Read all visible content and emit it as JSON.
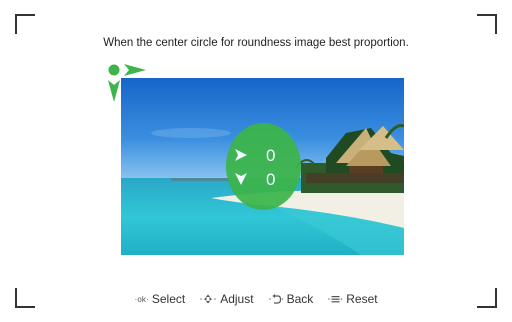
{
  "instruction": "When the center circle for roundness image best proportion.",
  "overlay": {
    "x_value": "0",
    "y_value": "0",
    "color": "#3cb54a"
  },
  "hints": {
    "select": {
      "key": "OK",
      "label": "Select"
    },
    "adjust": {
      "key": "arrows-icon",
      "label": "Adjust"
    },
    "back": {
      "key": "back-icon",
      "label": "Back"
    },
    "reset": {
      "key": "menu-icon",
      "label": "Reset"
    }
  }
}
